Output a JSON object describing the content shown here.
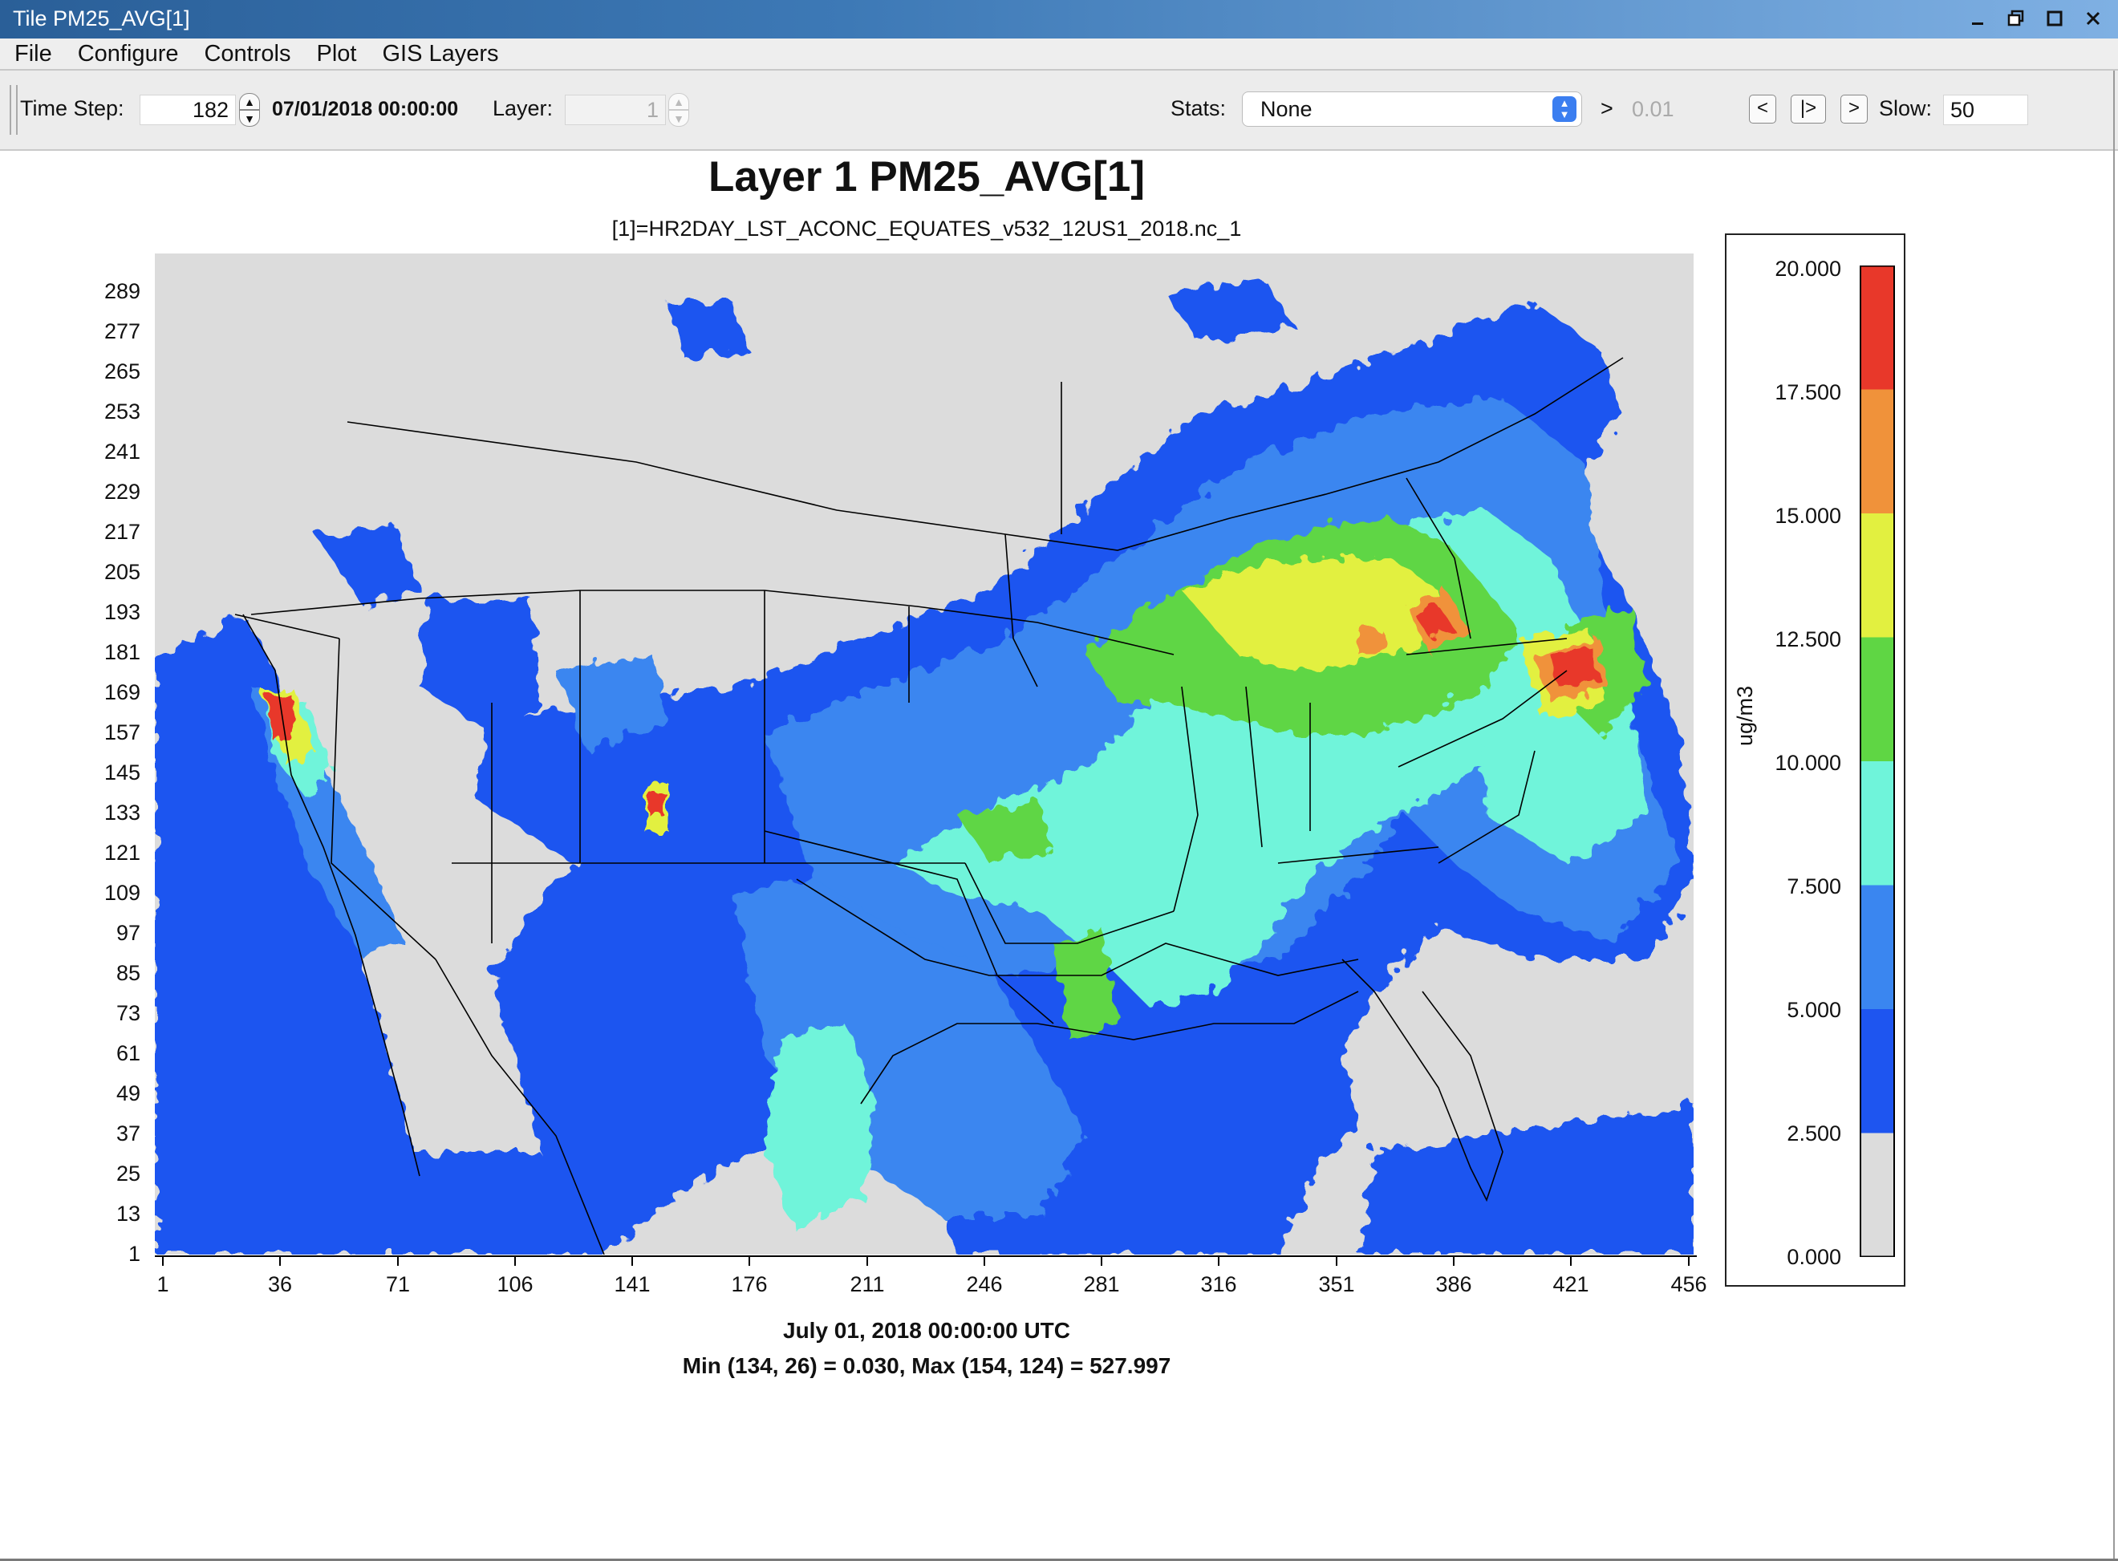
{
  "window": {
    "title": "Tile PM25_AVG[1]",
    "buttons": [
      "minimize-icon",
      "restore-icon",
      "maximize-icon",
      "close-icon"
    ]
  },
  "menu": [
    "File",
    "Configure",
    "Controls",
    "Plot",
    "GIS Layers"
  ],
  "toolbar": {
    "time_step_label": "Time Step:",
    "time_step_value": "182",
    "datetime": "07/01/2018 00:00:00",
    "layer_label": "Layer:",
    "layer_value": "1",
    "stats_label": "Stats:",
    "stats_value": "None",
    "threshold_symbol": ">",
    "threshold_value": "0.01",
    "prev_button": "<",
    "play_button": "|>",
    "next_button": ">",
    "slow_label": "Slow:",
    "slow_value": "50"
  },
  "plot": {
    "title": "Layer 1 PM25_AVG[1]",
    "subtitle": "[1]=HR2DAY_LST_ACONC_EQUATES_v532_12US1_2018.nc_1",
    "bottom_line1": "July 01, 2018 00:00:00 UTC",
    "bottom_line2": "Min (134, 26) = 0.030, Max (154, 124) = 527.997",
    "y_ticks": [
      "289",
      "277",
      "265",
      "253",
      "241",
      "229",
      "217",
      "205",
      "193",
      "181",
      "169",
      "157",
      "145",
      "133",
      "121",
      "109",
      "97",
      "85",
      "73",
      "61",
      "49",
      "37",
      "25",
      "13",
      "1"
    ],
    "x_ticks": [
      "1",
      "36",
      "71",
      "106",
      "141",
      "176",
      "211",
      "246",
      "281",
      "316",
      "351",
      "386",
      "421",
      "456"
    ]
  },
  "legend": {
    "unit": "ug/m3",
    "labels": [
      "20.000",
      "17.500",
      "15.000",
      "12.500",
      "10.000",
      "7.500",
      "5.000",
      "2.500",
      "0.000"
    ],
    "colors": [
      "#e8382a",
      "#f0923a",
      "#e2f040",
      "#5fd644",
      "#6ff4da",
      "#3a86f0",
      "#1e55f0",
      "#dcdcdc"
    ]
  },
  "map_colors": {
    "water_land_low": "#dcdcdc",
    "c1": "#1e55f0",
    "c2": "#3a86f0",
    "c3": "#6ff4da",
    "c4": "#5fd644",
    "c5": "#e2f040",
    "c6": "#f0923a",
    "c7": "#e8382a"
  }
}
